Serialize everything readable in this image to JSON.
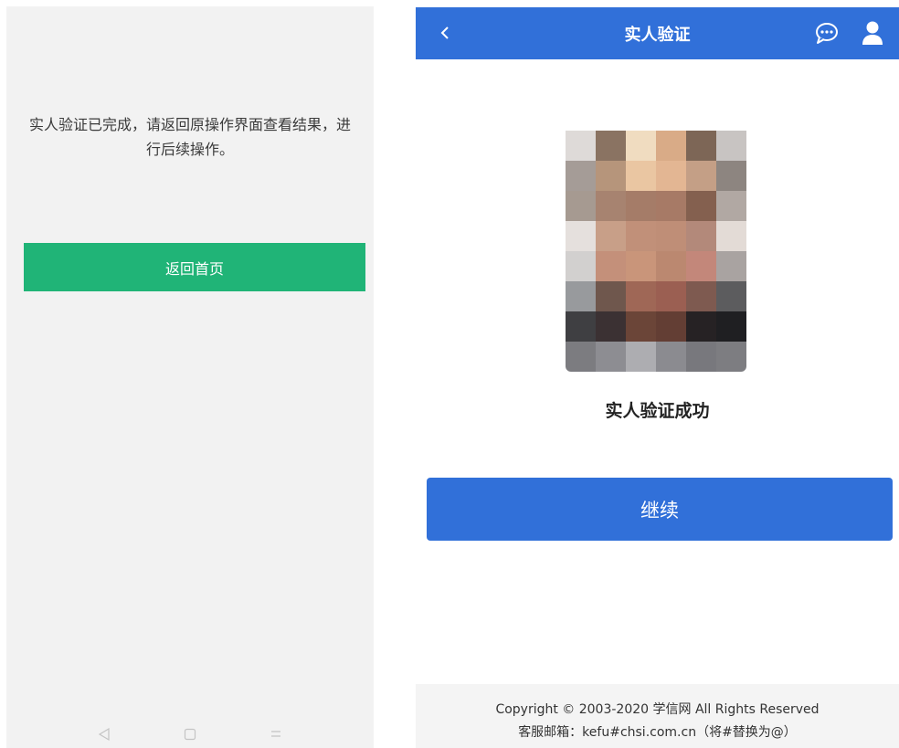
{
  "left_screen": {
    "message": "实人验证已完成，请返回原操作界面查看结果，进行后续操作。",
    "return_button_label": "返回首页",
    "button_color": "#20b477",
    "nav": {
      "back": "back-triangle-icon",
      "home": "home-square-icon",
      "menu": "menu-lines-icon"
    }
  },
  "right_screen": {
    "header": {
      "title": "实人验证",
      "back_label": "<",
      "background": "#3170d9",
      "icons": [
        "chat-bubble-icon",
        "user-icon"
      ]
    },
    "status_text": "实人验证成功",
    "continue_label": "继续",
    "footer": {
      "copyright": "Copyright © 2003-2020 学信网 All Rights Reserved",
      "contact": "客服邮箱：kefu#chsi.com.cn（将#替换为@）"
    }
  }
}
